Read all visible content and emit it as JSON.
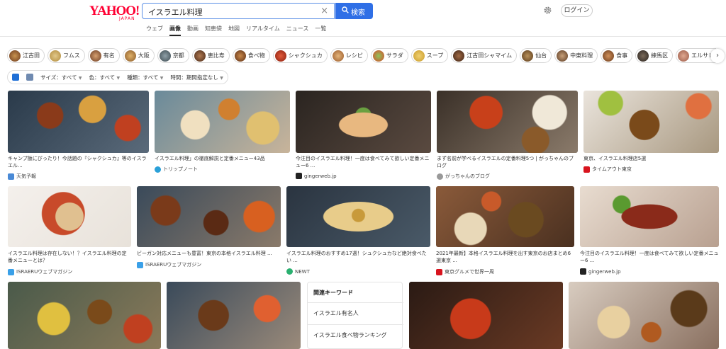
{
  "header": {
    "logo_text": "YAHOO!",
    "logo_sub": "JAPAN",
    "search_value": "イスラエル料理",
    "clear_symbol": "×",
    "search_button": "検索",
    "login": "ログイン",
    "tabs": [
      "ウェブ",
      "画像",
      "動画",
      "知恵袋",
      "地図",
      "リアルタイム",
      "ニュース",
      "一覧"
    ]
  },
  "chips": [
    "江古田",
    "フムス",
    "有名",
    "大阪",
    "京都",
    "恵比寿",
    "食べ物",
    "シャクシュカ",
    "レシピ",
    "サラダ",
    "スープ",
    "江古田シャマイム",
    "仙台",
    "中東料理",
    "食事",
    "練馬区",
    "エルサレム",
    ""
  ],
  "filters": {
    "size": "サイズ：すべて",
    "color": "色：すべて",
    "type": "種類：すべて",
    "time": "時間：期間指定なし"
  },
  "results": [
    {
      "caption": "キャンプ飯にぴったり！今話題の『シャクシュカ』等のイスラエル...",
      "source": "天気予報"
    },
    {
      "caption": "イスラエル料理」の徹底解説と定番メニュー43品",
      "source": "トリップノート"
    },
    {
      "caption": "今注目のイスラエル料理！一度は食べてみて欲しい定番メニュー6 ...",
      "source": "gingerweb.jp"
    },
    {
      "caption": "まず名前が学べるイスラエルの定番料理5つ | がっちゃんのブログ",
      "source": "がっちゃんのブログ"
    },
    {
      "caption": "東京、イスラエル料理店5選",
      "source": "タイムアウト東京"
    },
    {
      "caption": "イスラエル料理は存在しない！？イスラエル料理の定番メニューとは？",
      "source": "ISRAERUウェブマガジン"
    },
    {
      "caption": "ビーガン対応メニューも豊富！東京の本格イスラエル料理 ...",
      "source": "ISRAERUウェブマガジン"
    },
    {
      "caption": "イスラエル料理のおすすめ17選！シュクシュカなど絶対食べたい ...",
      "source": "NEWT"
    },
    {
      "caption": "2021年最新】本格イスラエル料理を出す東京のお店まとめ6選東京 ...",
      "source": "東京グルメで世界一周"
    },
    {
      "caption": "今注目のイスラエル料理！一度は食べてみて欲しい定番メニュー6 ...",
      "source": "gingerweb.jp"
    }
  ],
  "related": {
    "title": "関連キーワード",
    "items": [
      "イスラエル有名人",
      "イスラエル食べ物ランキング"
    ]
  }
}
